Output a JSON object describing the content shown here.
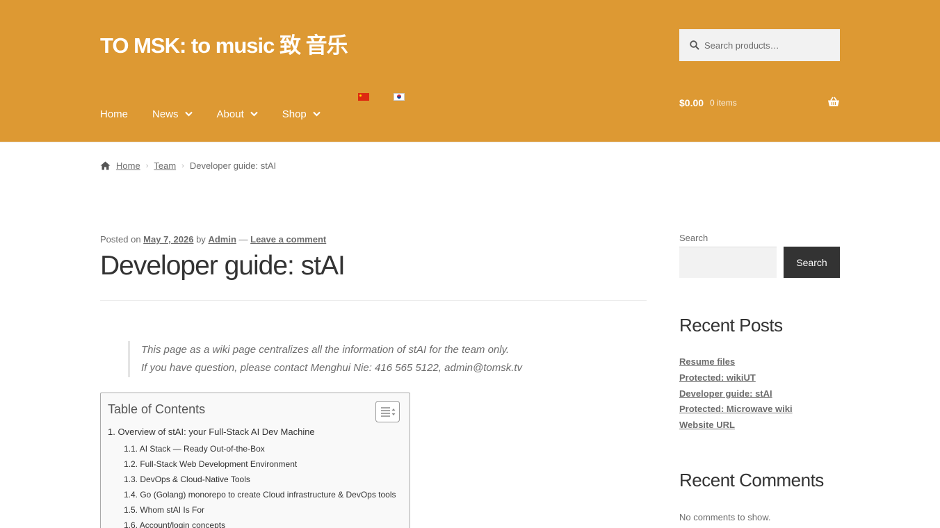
{
  "header": {
    "site_title": "TO MSK: to music 致 音乐",
    "search_placeholder": "Search products…",
    "nav": [
      {
        "label": "Home",
        "has_dropdown": false
      },
      {
        "label": "News",
        "has_dropdown": true
      },
      {
        "label": "About",
        "has_dropdown": true
      },
      {
        "label": "Shop",
        "has_dropdown": true
      }
    ],
    "cart": {
      "amount": "$0.00",
      "count": "0 items"
    },
    "colors": {
      "header_bg": "#dd9933"
    }
  },
  "breadcrumb": {
    "home": "Home",
    "team": "Team",
    "current": "Developer guide: stAI"
  },
  "post": {
    "posted_on": "Posted on",
    "date": "May 7, 2026",
    "by": "by",
    "author": "Admin",
    "dash": "—",
    "comment_link": "Leave a comment",
    "title": "Developer guide: stAI",
    "quote_line1": "This page as a wiki page centralizes all the information of stAI for the team only.",
    "quote_line2": "If you have question, please contact Menghui Nie: 416 565 5122, admin@tomsk.tv"
  },
  "toc": {
    "title": "Table of Contents",
    "items": [
      "1. Overview of stAI: your Full-Stack AI Dev Machine",
      "1.1. AI Stack — Ready Out-of-the-Box",
      "1.2. Full-Stack Web Development Environment",
      "1.3. DevOps & Cloud-Native Tools",
      "1.4. Go (Golang) monorepo to create Cloud infrastructure & DevOps tools",
      "1.5. Whom stAI Is For",
      "1.6. Account/login concepts"
    ]
  },
  "sidebar": {
    "search_label": "Search",
    "search_button": "Search",
    "recent_posts_title": "Recent Posts",
    "recent_posts": [
      "Resume files",
      "Protected: wikiUT",
      "Developer guide: stAI",
      "Protected: Microwave wiki",
      "Website URL"
    ],
    "recent_comments_title": "Recent Comments",
    "no_comments": "No comments to show."
  }
}
